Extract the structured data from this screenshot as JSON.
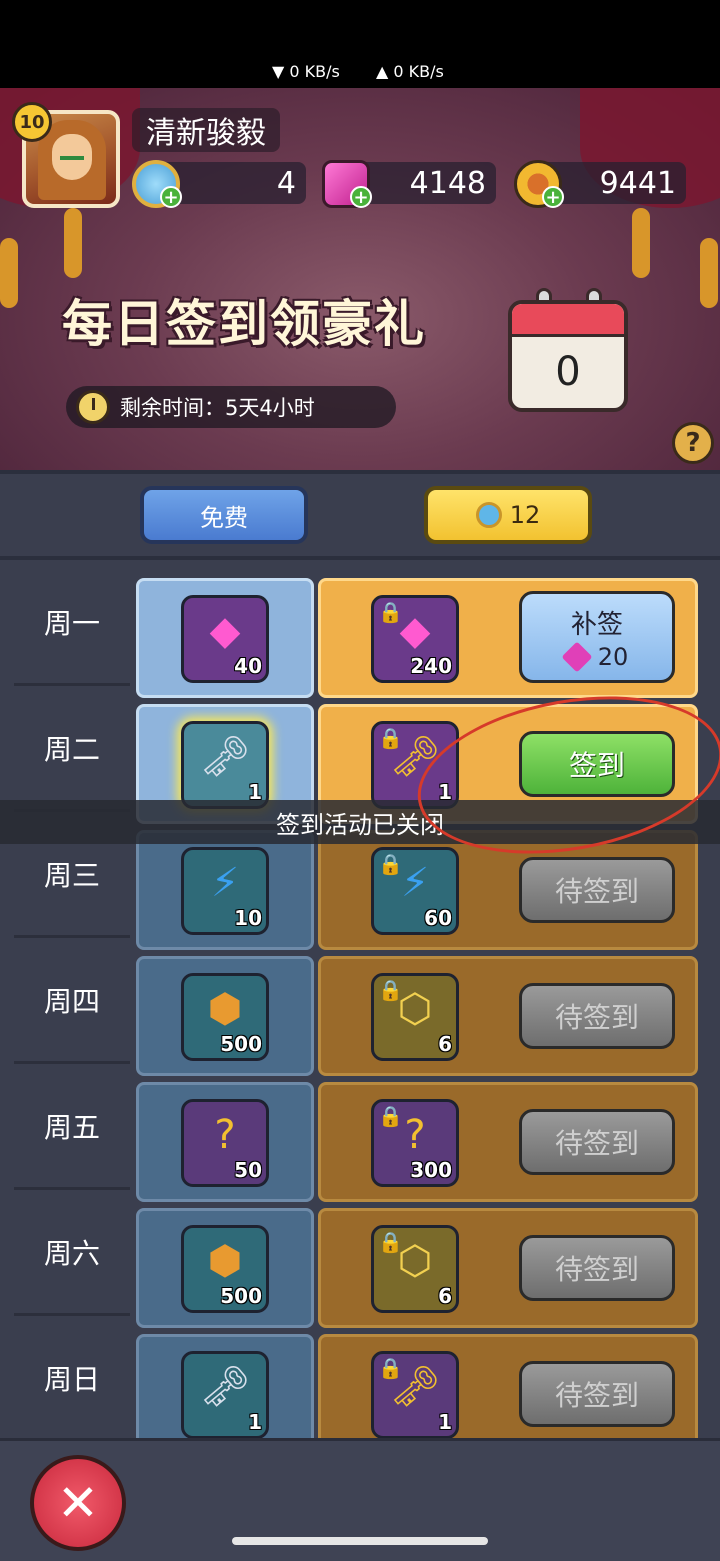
{
  "status": {
    "down_speed": "▼ 0 KB/s",
    "up_speed": "▲ 0 KB/s"
  },
  "player": {
    "level": "10",
    "name": "清新骏毅"
  },
  "currencies": [
    {
      "icon": "blue-coin-icon",
      "value": "4"
    },
    {
      "icon": "pink-gem-icon",
      "value": "4148"
    },
    {
      "icon": "gold-coin-icon",
      "value": "9441"
    }
  ],
  "event": {
    "title": "每日签到领豪礼",
    "timer_text": "剩余时间：5天4小时",
    "checkin_count": "0",
    "help": "?"
  },
  "tabs": {
    "free_label": "免费",
    "paid_value": "12"
  },
  "rows": [
    {
      "day": "周一",
      "free": {
        "icon": "pink-gem-icon",
        "qty": "40"
      },
      "paid": {
        "icon": "pink-gem-icon",
        "qty": "240"
      },
      "action": "补签",
      "action_cost": "20"
    },
    {
      "day": "周二",
      "free": {
        "icon": "silver-key-icon",
        "qty": "1"
      },
      "paid": {
        "icon": "gold-key-icon",
        "qty": "1"
      },
      "action": "签到"
    },
    {
      "day": "周三",
      "free": {
        "icon": "energy-bolt-icon",
        "qty": "10"
      },
      "paid": {
        "icon": "energy-bolt-icon",
        "qty": "60"
      },
      "action": "待签到"
    },
    {
      "day": "周四",
      "free": {
        "icon": "gold-coin-icon",
        "qty": "500"
      },
      "paid": {
        "icon": "gold-crystal-icon",
        "qty": "6"
      },
      "action": "待签到"
    },
    {
      "day": "周五",
      "free": {
        "icon": "mystery-puzzle-icon",
        "qty": "50"
      },
      "paid": {
        "icon": "mystery-puzzle-icon",
        "qty": "300"
      },
      "action": "待签到"
    },
    {
      "day": "周六",
      "free": {
        "icon": "gold-coin-icon",
        "qty": "500"
      },
      "paid": {
        "icon": "gold-crystal-icon",
        "qty": "6"
      },
      "action": "待签到"
    },
    {
      "day": "周日",
      "free": {
        "icon": "silver-key-icon",
        "qty": "1"
      },
      "paid": {
        "icon": "gold-key-icon",
        "qty": "1"
      },
      "action": "待签到"
    }
  ],
  "toast": "签到活动已关闭",
  "colors": {
    "sign_green": "#4eb33a",
    "wait_gray": "#6e6e6e",
    "paid_orange": "#f0b04a",
    "free_blue": "#8fb4dc",
    "annotation_red": "#d63a2a"
  }
}
